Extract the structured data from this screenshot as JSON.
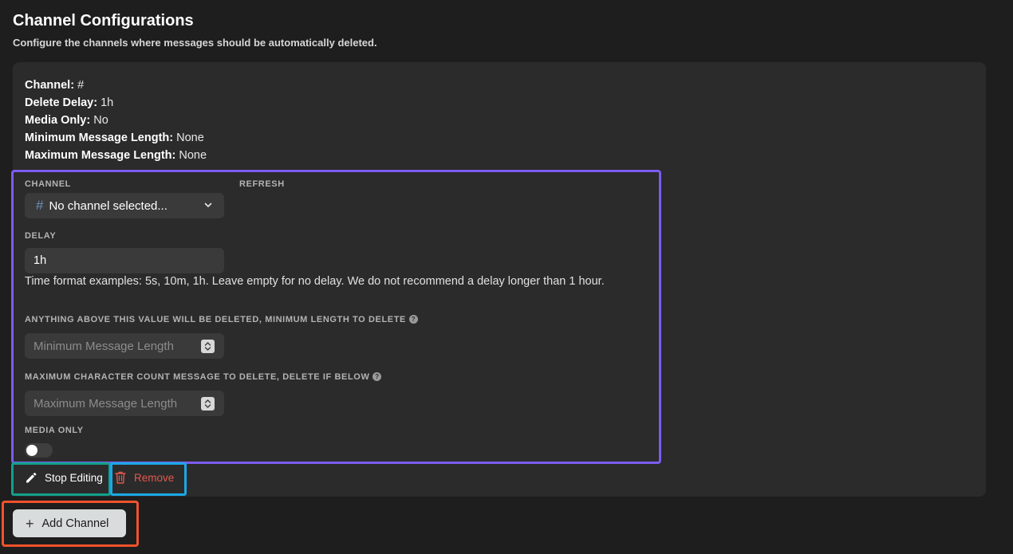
{
  "page": {
    "title": "Channel Configurations",
    "subtitle": "Configure the channels where messages should be automatically deleted."
  },
  "summary": {
    "channel_label": "Channel:",
    "channel_value": "#",
    "delay_label": "Delete Delay:",
    "delay_value": "1h",
    "media_label": "Media Only:",
    "media_value": "No",
    "min_label": "Minimum Message Length:",
    "min_value": "None",
    "max_label": "Maximum Message Length:",
    "max_value": "None"
  },
  "form": {
    "channel_label": "CHANNEL",
    "refresh_label": "REFRESH",
    "channel_select": {
      "icon": "hash-icon",
      "value": "No channel selected..."
    },
    "delay_label": "DELAY",
    "delay_value": "1h",
    "delay_hint": "Time format examples: 5s, 10m, 1h. Leave empty for no delay. We do not recommend a delay longer than 1 hour.",
    "min_label": "ANYTHING ABOVE THIS VALUE WILL BE DELETED, MINIMUM LENGTH TO DELETE",
    "min_placeholder": "Minimum Message Length",
    "max_label": "MAXIMUM CHARACTER COUNT MESSAGE TO DELETE, DELETE IF BELOW",
    "max_placeholder": "Maximum Message Length",
    "help_glyph": "?",
    "media_label": "MEDIA ONLY",
    "media_toggle_on": false
  },
  "actions": {
    "stop_editing": "Stop Editing",
    "remove": "Remove",
    "add_channel": "Add Channel",
    "add_glyph": "+"
  },
  "colors": {
    "background": "#1e1e1e",
    "card": "#2b2b2b",
    "field": "#3a3a3a",
    "remove": "#e0584d",
    "frame_edit": "#7b5cf0",
    "frame_stop": "#12a18c",
    "frame_remove": "#1ba8e6",
    "frame_add": "#f0522c"
  }
}
